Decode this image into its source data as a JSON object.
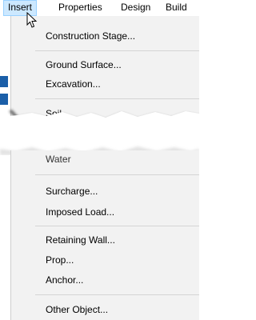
{
  "menubar": {
    "items": [
      {
        "label": "Insert",
        "active": true
      },
      {
        "label": "Properties",
        "active": false
      },
      {
        "label": "Design",
        "active": false
      },
      {
        "label": "Build",
        "active": false
      }
    ]
  },
  "menu": {
    "items": [
      {
        "label": "Construction Stage..."
      },
      {
        "label": "Ground Surface..."
      },
      {
        "label": "Excavation..."
      },
      {
        "label": "Soil..."
      },
      {
        "label": "Water"
      },
      {
        "label": "Surcharge..."
      },
      {
        "label": "Imposed Load..."
      },
      {
        "label": "Retaining Wall..."
      },
      {
        "label": "Prop..."
      },
      {
        "label": "Anchor..."
      },
      {
        "label": "Other Object..."
      }
    ]
  },
  "colors": {
    "menubar_highlight": "#cce8ff",
    "menu_background": "#f2f2f2",
    "backdrop_accent": "#1b5fa8"
  },
  "icons": {
    "cursor": "mouse-pointer-icon"
  }
}
